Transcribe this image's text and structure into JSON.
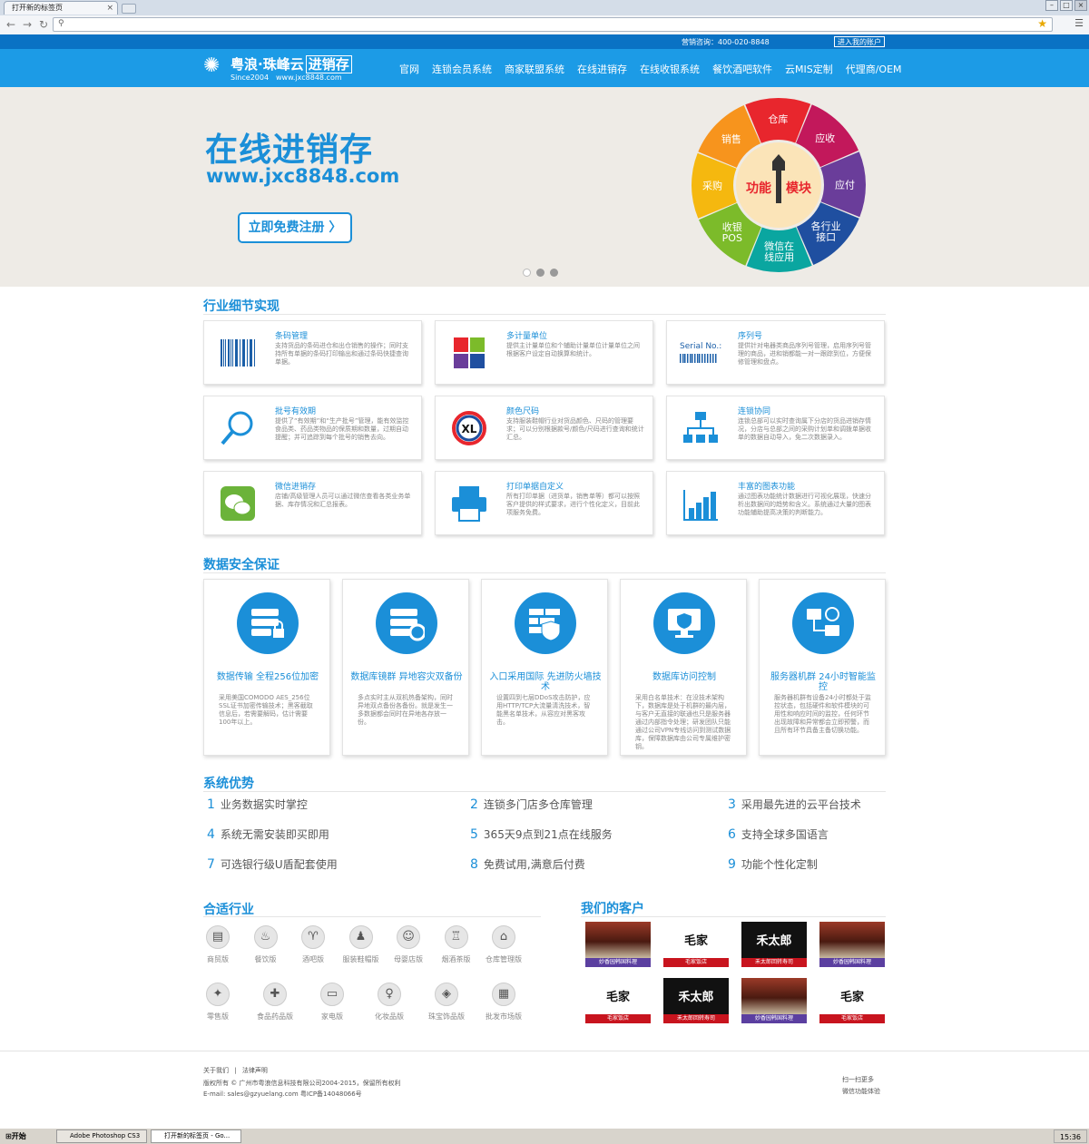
{
  "browser": {
    "tab_title": "打开新的标签页",
    "address": ""
  },
  "topbar": {
    "hotline": "营销咨询：400-020-8848",
    "login": "进入我的账户"
  },
  "header": {
    "logo_name": "粤浪·珠峰云",
    "logo_box": "进销存",
    "logo_since": "Since2004",
    "logo_url": "www.jxc8848.com",
    "nav": [
      "官网",
      "连锁会员系统",
      "商家联盟系统",
      "在线进销存",
      "在线收银系统",
      "餐饮酒吧软件",
      "云MIS定制",
      "代理商/OEM"
    ]
  },
  "banner": {
    "title": "在线进销存",
    "url": "www.jxc8848.com",
    "register": "立即免费注册 〉",
    "wheel_center_a": "功能",
    "wheel_center_b": "模块",
    "wheel_segments": [
      {
        "label": "销售",
        "color": "#f7941d"
      },
      {
        "label": "仓库",
        "color": "#e8262d"
      },
      {
        "label": "应收",
        "color": "#c2185b"
      },
      {
        "label": "应付",
        "color": "#6a3d9a"
      },
      {
        "label": "各行业 接口",
        "color": "#1f4fa0"
      },
      {
        "label": "微信在 线应用",
        "color": "#0aa6a0"
      },
      {
        "label": "收银 POS",
        "color": "#7cbb2a"
      },
      {
        "label": "采购",
        "color": "#f5b80f"
      }
    ],
    "slide_active": 1
  },
  "features": {
    "title": "行业细节实现",
    "items": [
      {
        "title": "条码管理",
        "desc": "支持货品的条码进仓和出仓销售的操作；同时支持所有单据的条码打印输出和通过条码快捷查询单据。",
        "icon": "barcode-icon"
      },
      {
        "title": "多计量单位",
        "desc": "提供主计量单位和个辅助计量单位计量单位之间根据客户设定自动换算和统计。",
        "icon": "puzzle-icon"
      },
      {
        "title": "序列号",
        "desc": "提供针对电器类商品序列号管理，启用序列号管理的商品，进和销都能一对一跟踪到位，方便保修管理和盘点。",
        "icon": "serial-icon"
      },
      {
        "title": "批号有效期",
        "desc": "提供了“有效期”和“生产批号”管理，能有效监控食品类、药品类物品的保质期和数量，过期自动提醒；并可追踪到每个批号的销售去向。",
        "icon": "magnifier-icon"
      },
      {
        "title": "颜色尺码",
        "desc": "支持服装鞋帽行业对货品颜色、尺码的管理要求；可以分别根据款号/颜色/尺码进行查询和统计汇总。",
        "icon": "color-size-icon"
      },
      {
        "title": "连锁协同",
        "desc": "连锁总部可以实时查询属下分店的货品进销存情况，分店与总部之间的采购计划单和调拨单据收单的数据自动导入，免二次数据录入。",
        "icon": "hierarchy-icon"
      },
      {
        "title": "微信进销存",
        "desc": "店铺/高级管理人员可以通过微信查看各类业务单据、库存情况和汇总报表。",
        "icon": "wechat-icon"
      },
      {
        "title": "打印单据自定义",
        "desc": "所有打印单据（进货单，销售单等）都可以按照客户提供的样式要求，进行个性化定义，目前此项服务免费。",
        "icon": "printer-icon"
      },
      {
        "title": "丰富的图表功能",
        "desc": "通过图表功能统计数据进行可视化展现，快速分析出数据间的趋势和含义。系统通过大量的图表功能辅助提高决策的判断能力。",
        "icon": "bar-chart-icon"
      }
    ]
  },
  "security": {
    "title": "数据安全保证",
    "items": [
      {
        "title": "数据传输 全程256位加密",
        "desc": "采用美国COMODO AES_256位SSL证书加密传输技术；黑客截取信息后，若需要解码，估计需要100年以上。",
        "icon": "server-lock-icon"
      },
      {
        "title": "数据库镜群 异地容灾双备份",
        "desc": "多点实时主从双机热备架构，同时异地双点备份各备份。就是发生一多数据都会同时在异地各存放一份。",
        "icon": "server-sync-icon"
      },
      {
        "title": "入口采用国际 先进防火墙技术",
        "desc": "设置四到七层DDoS攻击防护，应用HTTP/TCP大流量清洗技术，智能黑名单技术，从容应对黑客攻击。",
        "icon": "firewall-icon"
      },
      {
        "title": "数据库访问控制",
        "desc": "采用白名单技术：在没技术架构下，数据库是处于机群的最内层，与客户无直接的联通也只是服务器通过内部指令处理；研发团队只能通过公司VPN专线访问到测试数据库，保障数据库由公司专属维护密钥。",
        "icon": "monitor-shield-icon"
      },
      {
        "title": "服务器机群 24小时智能监控",
        "desc": "服务器机群有设备24小时都处于监控状态，包括硬件和软件模块的可用性和响应时间的监控，任何环节出现故障和异常都会立即预警，而且所有环节具备主备切换功能。",
        "icon": "network-monitor-icon"
      }
    ]
  },
  "advantages": {
    "title": "系统优势",
    "items": [
      {
        "num": "1",
        "text": "业务数据实时掌控"
      },
      {
        "num": "2",
        "text": "连锁多门店多仓库管理"
      },
      {
        "num": "3",
        "text": "采用最先进的云平台技术"
      },
      {
        "num": "4",
        "text": "系统无需安装即买即用"
      },
      {
        "num": "5",
        "text": "365天9点到21点在线服务"
      },
      {
        "num": "6",
        "text": "支持全球多国语言"
      },
      {
        "num": "7",
        "text": "可选银行级U盾配套使用"
      },
      {
        "num": "8",
        "text": "免费试用,满意后付费"
      },
      {
        "num": "9",
        "text": "功能个性化定制"
      }
    ]
  },
  "industries": {
    "title": "合适行业",
    "items": [
      {
        "label": "商贸版",
        "icon": "cart-icon",
        "glyph": "▤"
      },
      {
        "label": "餐饮版",
        "icon": "fork-knife-icon",
        "glyph": "♨"
      },
      {
        "label": "酒吧版",
        "icon": "wine-glass-icon",
        "glyph": "♈"
      },
      {
        "label": "服装鞋帽版",
        "icon": "tshirt-icon",
        "glyph": "♟"
      },
      {
        "label": "母婴店版",
        "icon": "stroller-icon",
        "glyph": "☺"
      },
      {
        "label": "烟酒茶版",
        "icon": "bottle-icon",
        "glyph": "♖"
      },
      {
        "label": "仓库管理版",
        "icon": "warehouse-icon",
        "glyph": "⌂"
      },
      {
        "label": "零售版",
        "icon": "candy-icon",
        "glyph": "✦"
      },
      {
        "label": "食品药品版",
        "icon": "pill-icon",
        "glyph": "✚"
      },
      {
        "label": "家电版",
        "icon": "tv-icon",
        "glyph": "▭"
      },
      {
        "label": "化妆品版",
        "icon": "cosmetics-icon",
        "glyph": "♀"
      },
      {
        "label": "珠宝饰品版",
        "icon": "jewelry-icon",
        "glyph": "◈"
      },
      {
        "label": "批发市场版",
        "icon": "package-icon",
        "glyph": "▦"
      }
    ]
  },
  "customers": {
    "title": "我们的客户",
    "items": [
      {
        "caption": "妙香园韩国料理",
        "bg": "#7a2a1e",
        "capbg": "#5b3fa0",
        "logo": ""
      },
      {
        "caption": "毛家饭店",
        "bg": "#ffffff",
        "capbg": "#c8141e",
        "logo": "毛家"
      },
      {
        "caption": "禾太郎回转寿司",
        "bg": "#111111",
        "capbg": "#c8141e",
        "logo": "禾太郎"
      },
      {
        "caption": "妙香园韩国料理",
        "bg": "#6a3020",
        "capbg": "#5b3fa0",
        "logo": ""
      },
      {
        "caption": "毛家饭店",
        "bg": "#ffffff",
        "capbg": "#c8141e",
        "logo": "毛家"
      },
      {
        "caption": "禾太郎回转寿司",
        "bg": "#111111",
        "capbg": "#c8141e",
        "logo": "禾太郎"
      },
      {
        "caption": "妙香园韩国料理",
        "bg": "#6a3020",
        "capbg": "#5b3fa0",
        "logo": ""
      },
      {
        "caption": "毛家饭店",
        "bg": "#ffffff",
        "capbg": "#c8141e",
        "logo": "毛家"
      }
    ]
  },
  "footer": {
    "links": [
      "关于我们",
      "法律声明"
    ],
    "copyright": "版权所有 © 广州市粤浪信息科技有限公司2004-2015，保留所有权利",
    "email": "E-mail: sales@gzyuelang.com 粤ICP备14048066号",
    "qr_a": "扫一扫更多",
    "qr_b": "微信功能体验"
  },
  "taskbar": {
    "start": "开始",
    "items": [
      "Adobe Photoshop CS3",
      "打开新的标签页 - Go..."
    ],
    "clock": "15:36"
  },
  "colors": {
    "accent": "#1b8fd8",
    "topbar": "#0a72c4",
    "header": "#1c9be6"
  }
}
